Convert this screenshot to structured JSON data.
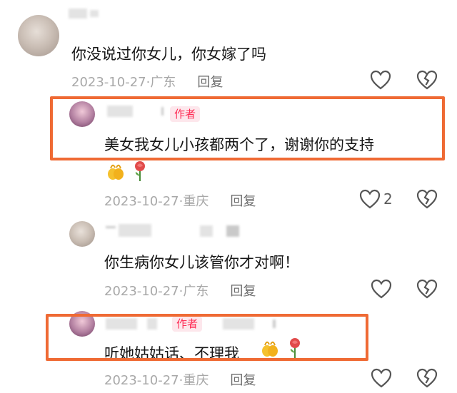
{
  "comments": [
    {
      "text": "你没说过你女儿，你女嫁了吗",
      "date": "2023-10-27",
      "region": "广东",
      "reply_label": "回复"
    },
    {
      "author_tag": "作者",
      "text": "美女我女儿小孩都两个了，谢谢你的支持",
      "date": "2023-10-27",
      "region": "重庆",
      "reply_label": "回复",
      "like_count": "2",
      "emojis": [
        "gold-hands-icon",
        "rose-icon"
      ]
    },
    {
      "text": "你生病你女儿该管你才对啊！",
      "date": "2023-10-27",
      "region": "广东",
      "reply_label": "回复"
    },
    {
      "author_tag": "作者",
      "text": "听她姑姑话、不理我",
      "date": "2023-10-27",
      "region": "重庆",
      "reply_label": "回复",
      "emojis": [
        "gold-hands-icon",
        "rose-icon"
      ]
    }
  ],
  "colors": {
    "highlight_box": "#ef6a34",
    "author_tag_bg": "#fde7ec",
    "author_tag_text": "#fe2c55"
  }
}
